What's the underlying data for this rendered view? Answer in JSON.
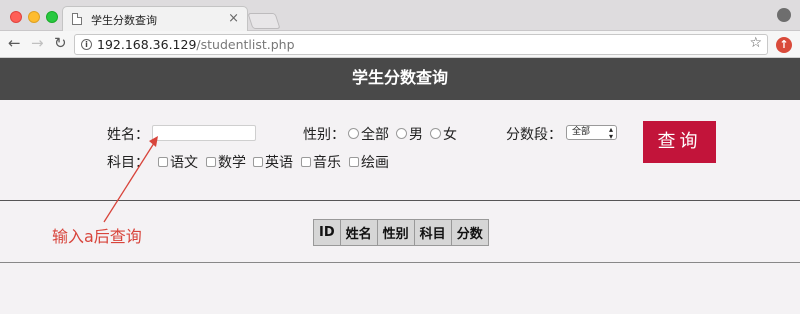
{
  "browser": {
    "tab_title": "学生分数查询",
    "tab_close": "×",
    "url_host": "192.168.36.129",
    "url_path": "/studentlist.php",
    "icons": {
      "back": "arrow-left-icon",
      "forward": "arrow-right-icon",
      "reload": "reload-icon",
      "info": "info-icon",
      "bookmark": "star-icon",
      "profile": "profile-icon",
      "extension": "upload-icon"
    },
    "glyphs": {
      "back": "←",
      "forward": "→",
      "reload": "↻",
      "info": "i",
      "star": "☆",
      "ext": "↑"
    }
  },
  "page": {
    "header_title": "学生分数查询",
    "colors": {
      "header_bg": "#494949",
      "button_bg": "#c2143a",
      "annotation": "#d8443b"
    }
  },
  "search": {
    "name_label": "姓名：",
    "name_value": "",
    "gender_label": "性别：",
    "gender_options": [
      "全部",
      "男",
      "女"
    ],
    "score_label": "分数段：",
    "score_selected": "全部",
    "subject_label": "科目：",
    "subject_options": [
      "语文",
      "数学",
      "英语",
      "音乐",
      "绘画"
    ],
    "query_button": "查询"
  },
  "results": {
    "columns": [
      "ID",
      "姓名",
      "性别",
      "科目",
      "分数"
    ]
  },
  "annotation": {
    "text": "输入a后查询"
  }
}
